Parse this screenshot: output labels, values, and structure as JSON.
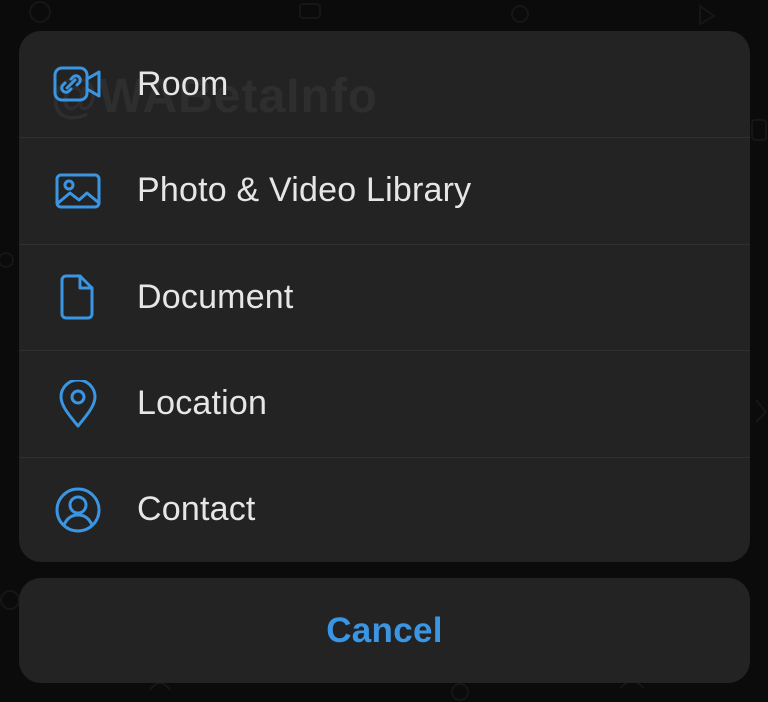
{
  "watermark": "@WABetaInfo",
  "accent_color": "#3a95e3",
  "menu": {
    "items": [
      {
        "label": "Room",
        "icon": "video-link-icon"
      },
      {
        "label": "Photo & Video Library",
        "icon": "photo-icon"
      },
      {
        "label": "Document",
        "icon": "document-icon"
      },
      {
        "label": "Location",
        "icon": "location-pin-icon"
      },
      {
        "label": "Contact",
        "icon": "contact-icon"
      }
    ]
  },
  "cancel": {
    "label": "Cancel"
  }
}
